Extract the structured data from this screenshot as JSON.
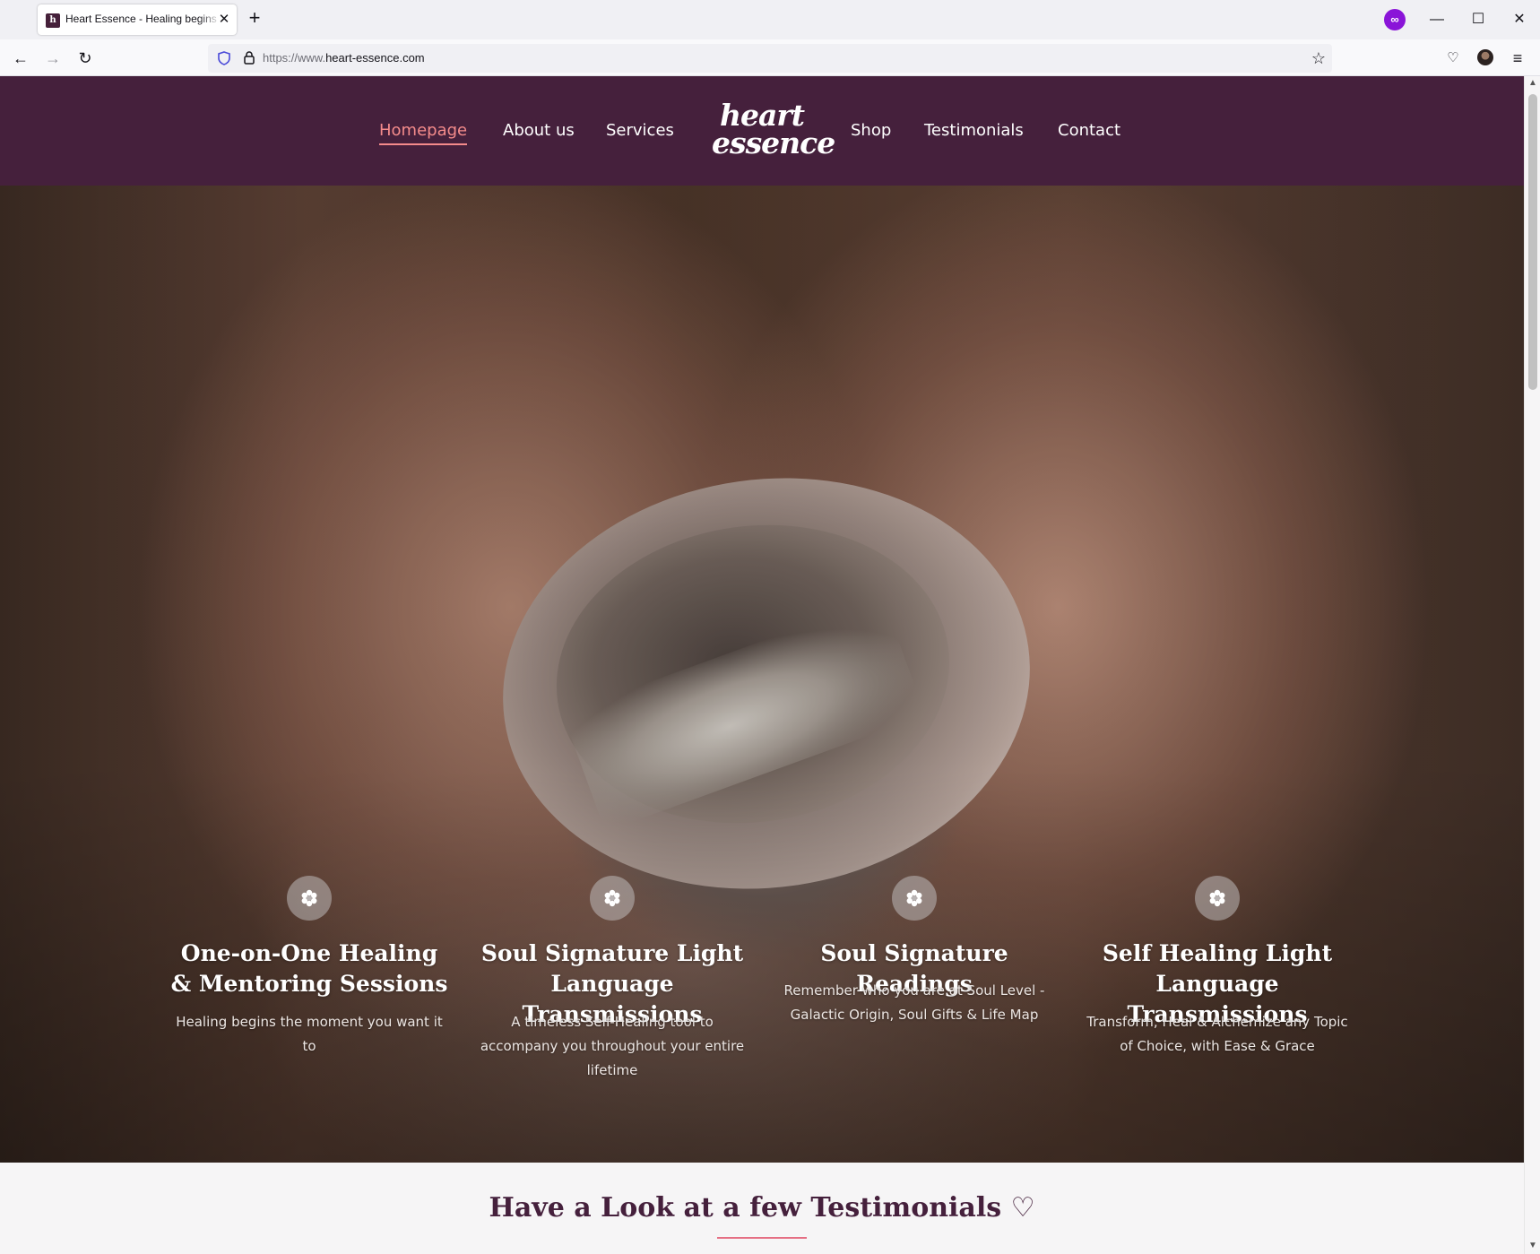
{
  "browser": {
    "tab_title": "Heart Essence - Healing begins",
    "tab_favicon": "h",
    "url_prefix": "https://www.",
    "url_domain": "heart-essence.com"
  },
  "site": {
    "nav_left": [
      "Homepage",
      "About us",
      "Services"
    ],
    "nav_right": [
      "Shop",
      "Testimonials",
      "Contact"
    ],
    "logo_line1": "heart",
    "logo_line2": "essence",
    "active_item": "Homepage",
    "colors": {
      "header_bg": "#45203c",
      "active": "#f48b8b"
    }
  },
  "services": [
    {
      "title": "One-on-One Healing & Mentoring Sessions",
      "text": "Healing begins the moment you want it to"
    },
    {
      "title": "Soul Signature Light Language Transmissions",
      "text": "A timeless Self-Healing tool to accompany you throughout your entire lifetime"
    },
    {
      "title": "Soul Signature Readings",
      "text": "Remember who you are at Soul Level - Galactic Origin, Soul Gifts & Life Map"
    },
    {
      "title": "Self Healing Light Language Transmissions",
      "text": "Transform, Heal & Alchemize any Topic of Choice, with Ease & Grace"
    }
  ],
  "testimonials": {
    "heading": "Have a Look at a few Testimonials ♡"
  }
}
